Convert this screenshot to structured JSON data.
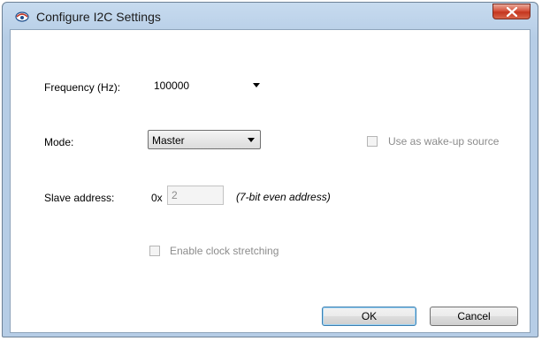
{
  "window": {
    "title": "Configure I2C Settings"
  },
  "frequency": {
    "label": "Frequency (Hz):",
    "value": "100000"
  },
  "mode": {
    "label": "Mode:",
    "value": "Master"
  },
  "wakeup": {
    "label": "Use as wake-up source",
    "checked": false,
    "enabled": false
  },
  "slave": {
    "label": "Slave address:",
    "prefix": "0x",
    "value": "2",
    "hint": "(7-bit even address)"
  },
  "clock_stretching": {
    "label": "Enable clock stretching",
    "checked": false,
    "enabled": false
  },
  "buttons": {
    "ok": "OK",
    "cancel": "Cancel"
  }
}
